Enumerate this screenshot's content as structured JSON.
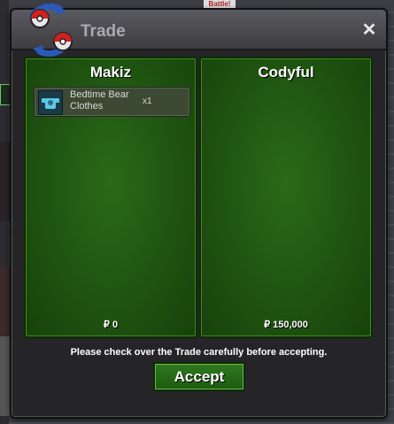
{
  "background": {
    "sign_text": "Battle!"
  },
  "window": {
    "title": "Trade",
    "close_glyph": "✕"
  },
  "left_panel": {
    "player_name": "Makiz",
    "items": [
      {
        "name": "Bedtime Bear Clothes",
        "quantity": "x1",
        "icon": "clothes-icon"
      }
    ],
    "money": "₽ 0"
  },
  "right_panel": {
    "player_name": "Codyful",
    "items": [],
    "money": "₽ 150,000"
  },
  "notice": "Please check over the Trade carefully before accepting.",
  "accept_label": "Accept",
  "colors": {
    "panel_green": "#1f5410",
    "accept_green": "#2f7a1f",
    "title_text": "#a8a8b0"
  }
}
